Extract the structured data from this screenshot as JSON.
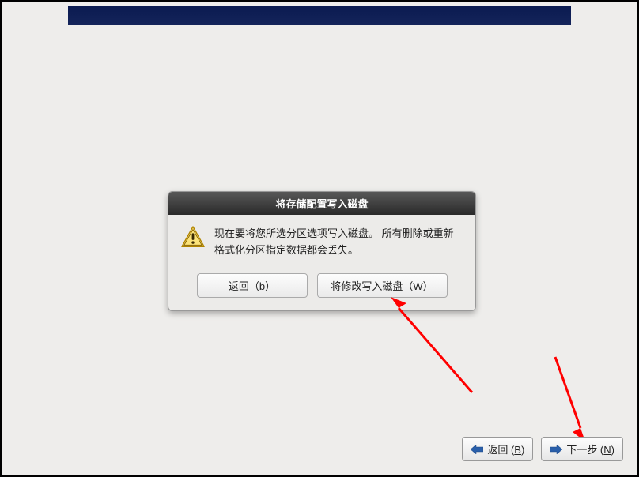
{
  "dialog": {
    "title": "将存储配置写入磁盘",
    "message": "现在要将您所选分区选项写入磁盘。 所有删除或重新格式化分区指定数据都会丢失。",
    "back_button": {
      "label_prefix": "返回（",
      "mnemonic": "b",
      "label_suffix": "）"
    },
    "write_button": {
      "label_prefix": "将修改写入磁盘（",
      "mnemonic": "W",
      "label_suffix": "）"
    }
  },
  "footer": {
    "back_button": {
      "label_prefix": "返回 (",
      "mnemonic": "B",
      "label_suffix": ")"
    },
    "next_button": {
      "label_prefix": "下一步 (",
      "mnemonic": "N",
      "label_suffix": ")"
    }
  },
  "colors": {
    "arrow": "#ff0000"
  }
}
